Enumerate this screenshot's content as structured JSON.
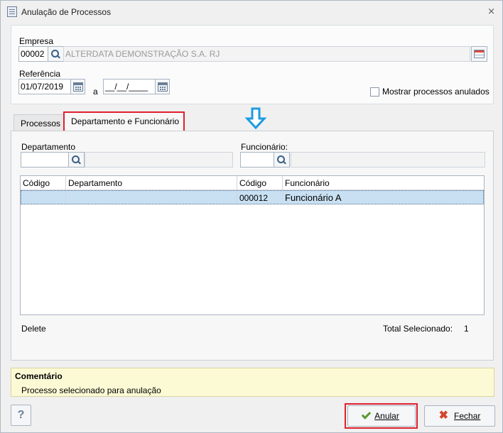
{
  "window": {
    "title": "Anulação de Processos",
    "close_glyph": "⨯"
  },
  "filters": {
    "empresa_label": "Empresa",
    "empresa_code": "00002",
    "empresa_name": "ALTERDATA DEMONSTRAÇÃO S.A. RJ",
    "referencia_label": "Referência",
    "referencia_from": "01/07/2019",
    "a_label": "a",
    "referencia_to": "__/__/____",
    "mostrar_label": "Mostrar processos anulados",
    "mostrar_checked": false
  },
  "tabs": [
    {
      "label": "Processos",
      "active": false
    },
    {
      "label": "Departamento e Funcionário",
      "active": true
    }
  ],
  "panel": {
    "departamento_label": "Departamento",
    "departamento_code": "",
    "departamento_name": "",
    "funcionario_label": "Funcionário:",
    "funcionario_code": "",
    "funcionario_name": ""
  },
  "table": {
    "headers": [
      "Código",
      "Departamento",
      "Código",
      "Funcionário"
    ],
    "rows": [
      {
        "dep_code": "",
        "dep_name": "",
        "func_code": "000012",
        "func_name": "Funcionário A"
      }
    ]
  },
  "footer": {
    "delete_label": "Delete",
    "total_label": "Total Selecionado:",
    "total_value": "1"
  },
  "comment": {
    "title": "Comentário",
    "text": "Processo selecionado para anulação"
  },
  "buttons": {
    "help_label": "?",
    "anular_label": "Anular",
    "fechar_label": "Fechar"
  },
  "colors": {
    "highlight": "#e0202e",
    "arrow": "#1e9be0",
    "selected_row": "#c8e0f2",
    "comment_bg": "#fcfad5"
  },
  "icons": [
    "window-app-icon",
    "close-icon",
    "search-icon",
    "calendar-icon",
    "grid-icon",
    "arrow-down-icon",
    "check-icon",
    "x-icon",
    "help-icon"
  ]
}
